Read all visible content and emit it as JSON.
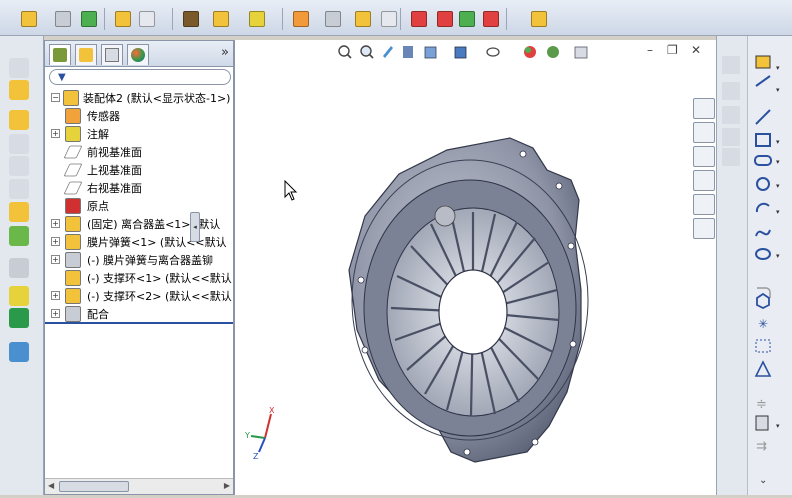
{
  "feature_manager": {
    "tabs": [
      "feature-manager-tab",
      "property-manager-tab",
      "configuration-manager-tab",
      "display-manager-tab"
    ],
    "expand_label": "»",
    "filter_icon": "funnel-icon",
    "tree": [
      {
        "label": "装配体2  (默认<显示状态-1>)",
        "icon": "assembly-icon",
        "expand": "−"
      },
      {
        "label": "传感器",
        "icon": "sensor-icon",
        "expand": ""
      },
      {
        "label": "注解",
        "icon": "annotation-icon",
        "expand": "+"
      },
      {
        "label": "前视基准面",
        "icon": "plane-icon",
        "expand": ""
      },
      {
        "label": "上视基准面",
        "icon": "plane-icon",
        "expand": ""
      },
      {
        "label": "右视基准面",
        "icon": "plane-icon",
        "expand": ""
      },
      {
        "label": "原点",
        "icon": "origin-icon",
        "expand": ""
      },
      {
        "label": "(固定) 离合器盖<1> (默认",
        "icon": "part-icon",
        "expand": "+"
      },
      {
        "label": "膜片弹簧<1> (默认<<默认",
        "icon": "part-icon",
        "expand": "+"
      },
      {
        "label": "(-) 膜片弹簧与离合器盖铆",
        "icon": "rivet-icon",
        "expand": "+"
      },
      {
        "label": "(-) 支撑环<1> (默认<<默认",
        "icon": "part-icon",
        "expand": ""
      },
      {
        "label": "(-) 支撑环<2> (默认<<默认",
        "icon": "part-icon",
        "expand": "+"
      },
      {
        "label": "配合",
        "icon": "mates-icon",
        "expand": "+"
      }
    ]
  },
  "triad": {
    "x": "X",
    "y": "Y",
    "z": "Z"
  },
  "window_controls": {
    "minimize": "–",
    "restore": "❐",
    "close": "✕"
  },
  "colors": {
    "accent": "#2a50a0",
    "part_gray": "#8a8f9c"
  }
}
